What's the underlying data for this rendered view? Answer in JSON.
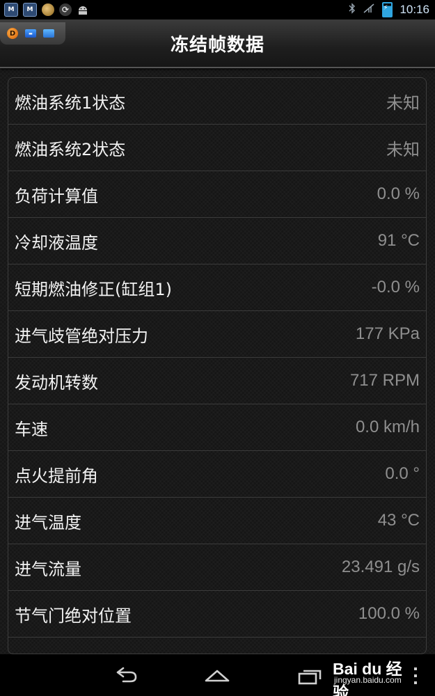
{
  "status_bar": {
    "left_icons": [
      "m-app-icon",
      "m-app-icon-2",
      "coin-icon",
      "sync-icon",
      "android-icon"
    ],
    "m_label": "M",
    "m2_label": "M",
    "time": "10:16"
  },
  "header": {
    "badge_label": "D",
    "title": "冻结帧数据"
  },
  "rows": [
    {
      "label": "燃油系统1状态",
      "value": "未知"
    },
    {
      "label": "燃油系统2状态",
      "value": "未知"
    },
    {
      "label": "负荷计算值",
      "value": "0.0 %"
    },
    {
      "label": "冷却液温度",
      "value": "91 °C"
    },
    {
      "label": "短期燃油修正(缸组1)",
      "value": "-0.0 %"
    },
    {
      "label": "进气歧管绝对压力",
      "value": "177 KPa"
    },
    {
      "label": "发动机转数",
      "value": "717 RPM"
    },
    {
      "label": "车速",
      "value": "0.0 km/h"
    },
    {
      "label": "点火提前角",
      "value": "0.0 °"
    },
    {
      "label": "进气温度",
      "value": "43 °C"
    },
    {
      "label": "进气流量",
      "value": "23.491 g/s"
    },
    {
      "label": "节气门绝对位置",
      "value": "100.0 %"
    }
  ],
  "watermark": {
    "logo": "Bai du 经验",
    "url": "jingyan.baidu.com"
  },
  "colors": {
    "background": "#151515",
    "label": "#f2f2f2",
    "value": "#8f8f8f",
    "accent_blue": "#2fa5e0"
  }
}
